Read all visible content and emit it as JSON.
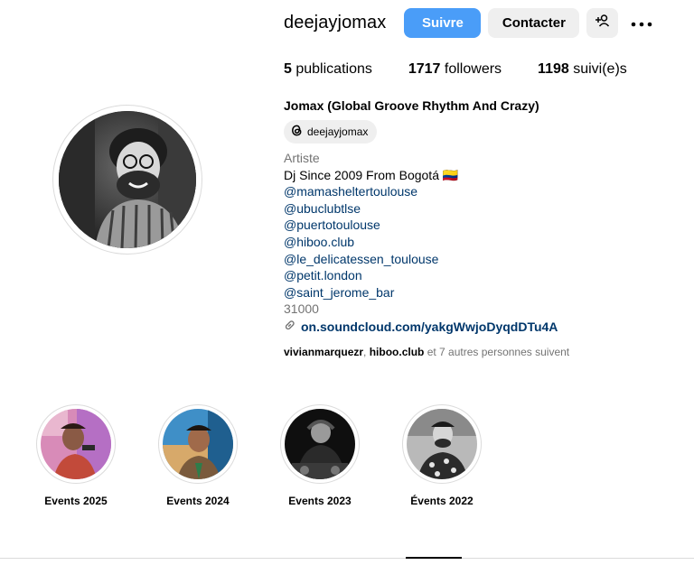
{
  "profile": {
    "username": "deejayjomax",
    "full_name": "Jomax (Global Groove Rhythm And Crazy)",
    "threads_handle": "deejayjomax",
    "category": "Artiste",
    "bio_line": "Dj Since 2009 From Bogotá 🇨🇴",
    "mentions": [
      "@mamasheltertoulouse",
      "@ubuclubtlse",
      "@puertotoulouse",
      "@hiboo.club",
      "@le_delicatessen_toulouse",
      "@petit.london",
      "@saint_jerome_bar"
    ],
    "postal": "31000",
    "link": "on.soundcloud.com/yakgWwjoDyqdDTu4A"
  },
  "actions": {
    "follow_label": "Suivre",
    "contact_label": "Contacter",
    "adduser_icon": "add-user-icon",
    "more_icon": "more-horizontal-icon"
  },
  "stats": {
    "posts_count": "5",
    "posts_label": "publications",
    "followers_count": "1717",
    "followers_label": "followers",
    "following_count": "1198",
    "following_label": "suivi(e)s"
  },
  "followed_by": {
    "user1": "vivianmarquezr",
    "sep": ", ",
    "user2": "hiboo.club",
    "rest": " et 7 autres personnes suivent"
  },
  "highlights": [
    {
      "label": "Events 2025"
    },
    {
      "label": "Events 2024"
    },
    {
      "label": "Events 2023"
    },
    {
      "label": "Évents 2022"
    }
  ],
  "colors": {
    "follow_button": "#4a9df8",
    "secondary_button": "#efefef",
    "link_blue": "#00376b",
    "muted_text": "#737373"
  }
}
